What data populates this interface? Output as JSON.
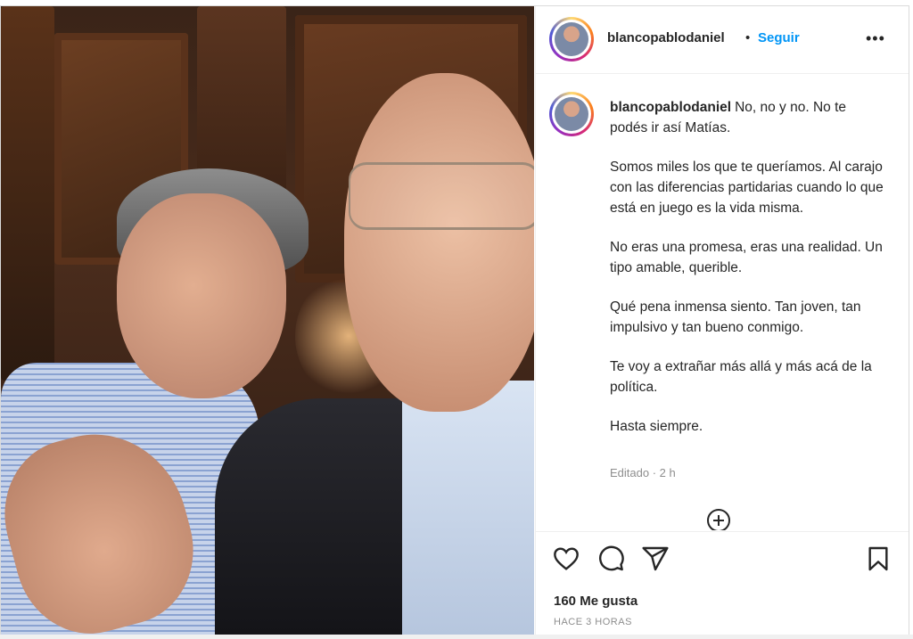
{
  "post": {
    "username": "blancopablodaniel",
    "separator": "•",
    "follow_label": "Seguir",
    "more_label": "•••",
    "caption_paragraphs": [
      "No, no y no. No te podés ir así Matías.",
      "Somos miles los que te queríamos. Al carajo con las diferencias partidarias cuando lo que está en juego es la vida misma.",
      "No eras una promesa, eras una realidad. Un tipo amable, querible.",
      "Qué pena inmensa siento. Tan joven, tan impulsivo y tan bueno conmigo.",
      "Te voy a extrañar más allá y más acá de la política.",
      "Hasta siempre."
    ],
    "edited_label": "Editado · 2 h",
    "likes_label": "160 Me gusta",
    "timestamp": "HACE 3 HORAS"
  },
  "icons": {
    "like": "heart-icon",
    "comment": "comment-icon",
    "share": "send-icon",
    "save": "bookmark-icon",
    "add_comment": "plus-circle-icon"
  },
  "colors": {
    "follow": "#0095f6",
    "text": "#262626",
    "muted": "#8e8e8e",
    "border": "#dbdbdb"
  }
}
